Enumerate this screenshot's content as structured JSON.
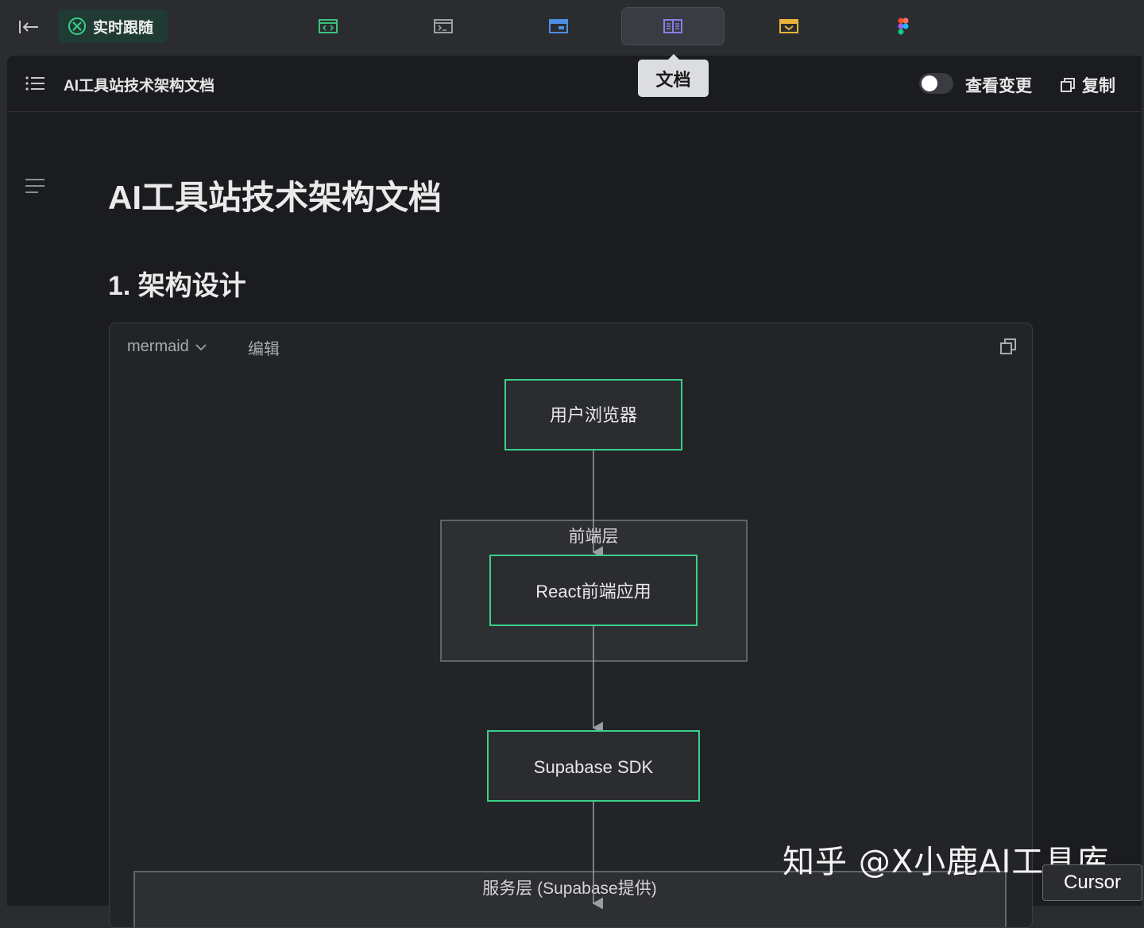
{
  "topbar": {
    "follow_label": "实时跟随",
    "tabs": [
      {
        "icon": "code-window-icon",
        "color": "#3fbf7f"
      },
      {
        "icon": "terminal-icon",
        "color": "#9aa0a6"
      },
      {
        "icon": "browser-window-icon",
        "color": "#4d8fe8"
      },
      {
        "icon": "document-icon",
        "color": "#8f7be8",
        "active": true
      },
      {
        "icon": "mail-tray-icon",
        "color": "#e8b43c"
      },
      {
        "icon": "figma-icon",
        "color": "#e8553c"
      }
    ],
    "tooltip": "文档"
  },
  "doc_header": {
    "title": "AI工具站技术架构文档",
    "view_changes_label": "查看变更",
    "copy_label": "复制"
  },
  "doc": {
    "title": "AI工具站技术架构文档",
    "section_1": "1. 架构设计"
  },
  "code_block": {
    "language": "mermaid",
    "edit_label": "编辑"
  },
  "diagram": {
    "accent_color": "#3ad08a",
    "nodes": {
      "browser": "用户浏览器",
      "react_app": "React前端应用",
      "supabase_sdk": "Supabase SDK"
    },
    "subgraphs": {
      "frontend": "前端层",
      "service": "服务层 (Supabase提供)"
    }
  },
  "overlay": {
    "watermark": "知乎 @X小鹿AI工具库",
    "cursor_tag": "Cursor"
  }
}
